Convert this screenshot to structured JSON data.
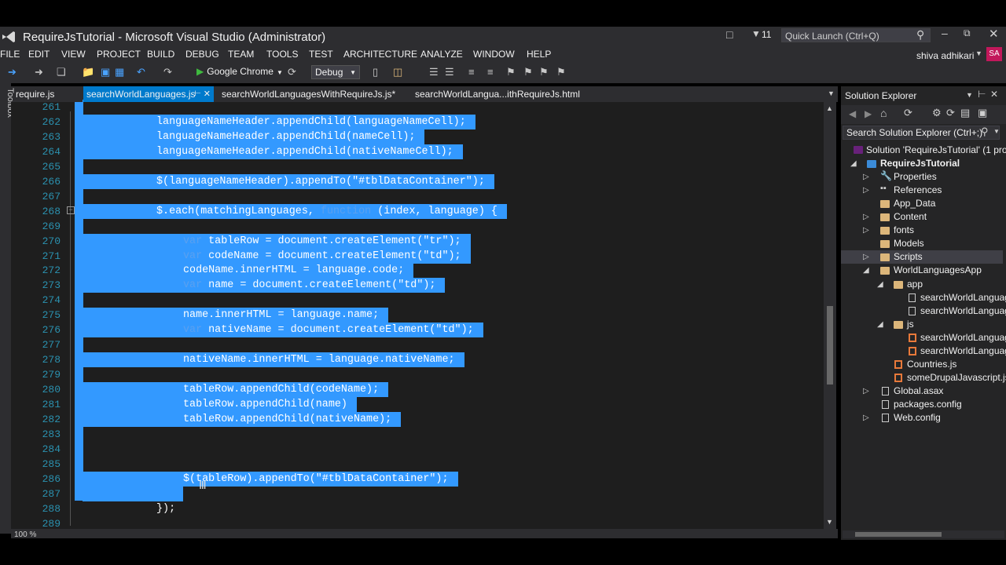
{
  "window": {
    "title": "RequireJsTutorial - Microsoft Visual Studio (Administrator)",
    "notification_count": "11",
    "quick_launch_placeholder": "Quick Launch (Ctrl+Q)"
  },
  "user": {
    "name": "shiva adhikari",
    "initials": "SA"
  },
  "menu": [
    "FILE",
    "EDIT",
    "VIEW",
    "PROJECT",
    "BUILD",
    "DEBUG",
    "TEAM",
    "TOOLS",
    "TEST",
    "ARCHITECTURE",
    "ANALYZE",
    "WINDOW",
    "HELP"
  ],
  "toolbar": {
    "run_target": "Google Chrome",
    "configuration": "Debug"
  },
  "tabs": [
    "require.js",
    "searchWorldLanguages.js",
    "searchWorldLanguagesWithRequireJs.js*",
    "searchWorldLangua...ithRequireJs.html"
  ],
  "toolbox_label": "Toolbox",
  "editor": {
    "zoom": "100 %",
    "lines": [
      {
        "n": "261",
        "segs": []
      },
      {
        "n": "262",
        "segs": [
          [
            "t",
            "languageNameHeader.appendChild(languageNameCell);"
          ]
        ]
      },
      {
        "n": "263",
        "segs": [
          [
            "t",
            "languageNameHeader.appendChild(nameCell);"
          ]
        ]
      },
      {
        "n": "264",
        "segs": [
          [
            "t",
            "languageNameHeader.appendChild(nativeNameCell);"
          ]
        ]
      },
      {
        "n": "265",
        "segs": []
      },
      {
        "n": "266",
        "segs": [
          [
            "t",
            "$(languageNameHeader).appendTo(\"#tblDataContainer\");"
          ]
        ]
      },
      {
        "n": "267",
        "segs": []
      },
      {
        "n": "268",
        "segs": [
          [
            "t",
            "$.each(matchingLanguages, "
          ],
          [
            "k",
            "function"
          ],
          [
            "t",
            " (index, language) {"
          ]
        ]
      },
      {
        "n": "269",
        "segs": []
      },
      {
        "n": "270",
        "segs": [
          [
            "k",
            "var"
          ],
          [
            "t",
            " tableRow = document.createElement(\"tr\");"
          ]
        ]
      },
      {
        "n": "271",
        "segs": [
          [
            "k",
            "var"
          ],
          [
            "t",
            " codeName = document.createElement(\"td\");"
          ]
        ]
      },
      {
        "n": "272",
        "segs": [
          [
            "t",
            "codeName.innerHTML = language.code;"
          ]
        ]
      },
      {
        "n": "273",
        "segs": [
          [
            "k",
            "var"
          ],
          [
            "t",
            " name = document.createElement(\"td\");"
          ]
        ]
      },
      {
        "n": "274",
        "segs": []
      },
      {
        "n": "275",
        "segs": [
          [
            "t",
            "name.innerHTML = language.name;"
          ]
        ]
      },
      {
        "n": "276",
        "segs": [
          [
            "k",
            "var"
          ],
          [
            "t",
            " nativeName = document.createElement(\"td\");"
          ]
        ]
      },
      {
        "n": "277",
        "segs": []
      },
      {
        "n": "278",
        "segs": [
          [
            "t",
            "nativeName.innerHTML = language.nativeName;"
          ]
        ]
      },
      {
        "n": "279",
        "segs": []
      },
      {
        "n": "280",
        "segs": [
          [
            "t",
            "tableRow.appendChild(codeName);"
          ]
        ]
      },
      {
        "n": "281",
        "segs": [
          [
            "t",
            "tableRow.appendChild(name)"
          ]
        ]
      },
      {
        "n": "282",
        "segs": [
          [
            "t",
            "tableRow.appendChild(nativeName);"
          ]
        ]
      },
      {
        "n": "283",
        "segs": []
      },
      {
        "n": "284",
        "segs": []
      },
      {
        "n": "285",
        "segs": []
      },
      {
        "n": "286",
        "segs": [
          [
            "t",
            "$(tableRow).appendTo(\"#tblDataContainer\");"
          ]
        ]
      },
      {
        "n": "287",
        "segs": []
      },
      {
        "n": "288",
        "segs": [
          [
            "t",
            "});"
          ]
        ]
      },
      {
        "n": "289",
        "segs": []
      }
    ]
  },
  "solution_explorer": {
    "title": "Solution Explorer",
    "search_placeholder": "Search Solution Explorer (Ctrl+;)",
    "items": [
      "Solution 'RequireJsTutorial' (1 proj",
      "RequireJsTutorial",
      "Properties",
      "References",
      "App_Data",
      "Content",
      "fonts",
      "Models",
      "Scripts",
      "WorldLanguagesApp",
      "app",
      "searchWorldLanguag",
      "searchWorldLanguag",
      "js",
      "searchWorldLanguag",
      "searchWorldLanguag",
      "Countries.js",
      "someDrupalJavascript.js",
      "Global.asax",
      "packages.config",
      "Web.config"
    ]
  },
  "colors": {
    "accent": "#007acc",
    "selection": "#3399ff",
    "chrome": "#2d2d30",
    "editor_bg": "#1e1e1e",
    "line_numbers": "#2b91af"
  }
}
